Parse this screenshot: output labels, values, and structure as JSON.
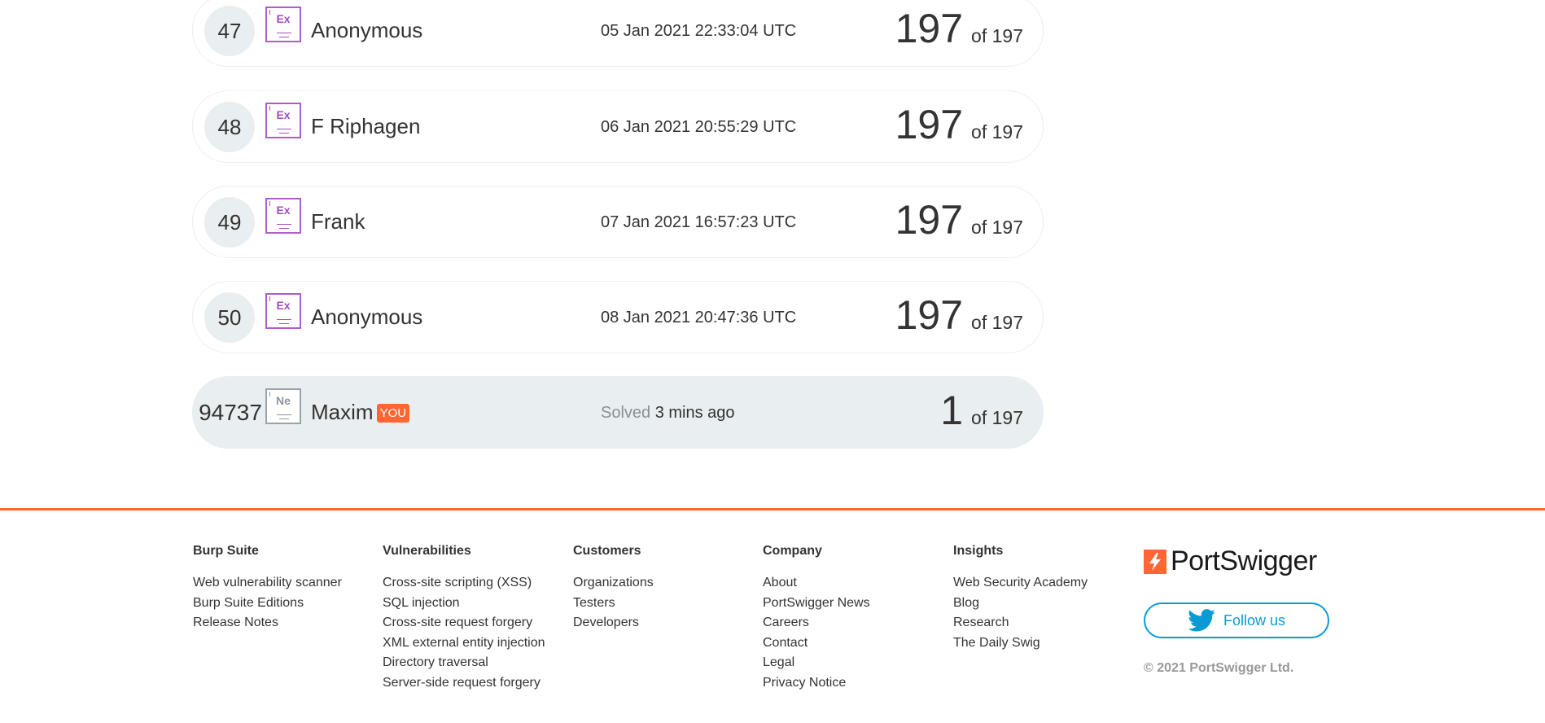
{
  "leaderboard": {
    "rows": [
      {
        "rank": "47",
        "level": "Ex",
        "name": "Anonymous",
        "date": "05 Jan 2021 22:33:04 UTC",
        "score": "197",
        "total": "of 197"
      },
      {
        "rank": "48",
        "level": "Ex",
        "name": "F Riphagen",
        "date": "06 Jan 2021 20:55:29 UTC",
        "score": "197",
        "total": "of 197"
      },
      {
        "rank": "49",
        "level": "Ex",
        "name": "Frank",
        "date": "07 Jan 2021 16:57:23 UTC",
        "score": "197",
        "total": "of 197"
      },
      {
        "rank": "50",
        "level": "Ex",
        "name": "Anonymous",
        "date": "08 Jan 2021 20:47:36 UTC",
        "score": "197",
        "total": "of 197"
      }
    ],
    "me": {
      "rank": "94737",
      "level": "Ne",
      "name": "Maxim",
      "you_tag": "YOU",
      "solved_label": "Solved",
      "solved_time": "3 mins ago",
      "score": "1",
      "total": "of 197"
    }
  },
  "footer": {
    "columns": [
      {
        "heading": "Burp Suite",
        "links": [
          "Web vulnerability scanner",
          "Burp Suite Editions",
          "Release Notes"
        ]
      },
      {
        "heading": "Vulnerabilities",
        "links": [
          "Cross-site scripting (XSS)",
          "SQL injection",
          "Cross-site request forgery",
          "XML external entity injection",
          "Directory traversal",
          "Server-side request forgery"
        ]
      },
      {
        "heading": "Customers",
        "links": [
          "Organizations",
          "Testers",
          "Developers"
        ]
      },
      {
        "heading": "Company",
        "links": [
          "About",
          "PortSwigger News",
          "Careers",
          "Contact",
          "Legal",
          "Privacy Notice"
        ]
      },
      {
        "heading": "Insights",
        "links": [
          "Web Security Academy",
          "Blog",
          "Research",
          "The Daily Swig"
        ]
      }
    ],
    "brand": "PortSwigger",
    "follow_label": "Follow us",
    "copyright": "© 2021 PortSwigger Ltd."
  },
  "colors": {
    "accent": "#ff6633",
    "twitter": "#0a9bd6",
    "expert_badge": "#b05dc8"
  },
  "icons": {
    "logo": "portswigger-logo-icon",
    "twitter": "twitter-bird-icon"
  }
}
